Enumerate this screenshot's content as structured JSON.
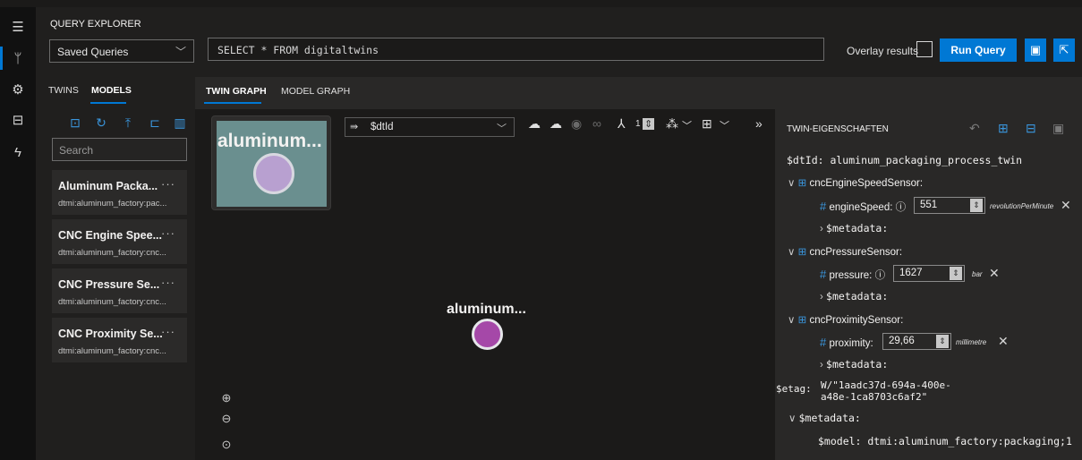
{
  "rail": {
    "icons": [
      "hamburger-icon",
      "graph-icon",
      "models-icon",
      "briefcase-icon",
      "lightning-icon"
    ]
  },
  "topbar": {
    "title": "QUERY EXPLORER",
    "saved_queries": "Saved Queries",
    "query": "SELECT * FROM digitaltwins",
    "overlay_label": "Overlay results",
    "run_query": "Run Query"
  },
  "left_panel": {
    "tabs": [
      "TWINS",
      "MODELS"
    ],
    "active_tab": "MODELS",
    "search_placeholder": "Search",
    "models": [
      {
        "name": "Aluminum Packa...",
        "id": "dtmi:aluminum_factory:pac..."
      },
      {
        "name": "CNC Engine Spee...",
        "id": "dtmi:aluminum_factory:cnc..."
      },
      {
        "name": "CNC Pressure Se...",
        "id": "dtmi:aluminum_factory:cnc..."
      },
      {
        "name": "CNC Proximity Se...",
        "id": "dtmi:aluminum_factory:cnc..."
      }
    ],
    "more": "···"
  },
  "center": {
    "tabs": [
      "TWIN GRAPH",
      "MODEL GRAPH"
    ],
    "active_tab": "TWIN GRAPH",
    "minimap_label": "aluminum...",
    "dtid_select": "$dtId",
    "node_label": "aluminum...",
    "layer_count": "1"
  },
  "properties": {
    "title": "TWIN-EIGENSCHAFTEN",
    "dtid_line": "$dtId: aluminum_packaging_process_twin",
    "components": [
      {
        "name": "cncEngineSpeedSensor:",
        "prop": "engineSpeed:",
        "value": "551",
        "unit": "revolutionPerMinute"
      },
      {
        "name": "cncPressureSensor:",
        "prop": "pressure:",
        "value": "1627",
        "unit": "bar"
      },
      {
        "name": "cncProximitySensor:",
        "prop": "proximity:",
        "value": "29,66",
        "unit": "millimetre"
      }
    ],
    "metadata_label": "$metadata:",
    "etag_key": "$etag:",
    "etag_line1": "W/\"1aadc37d-694a-400e-",
    "etag_line2": "a48e-1ca8703c6af2\"",
    "metadata_root": "$metadata:",
    "model_line": "$model: dtmi:aluminum_factory:packaging;1"
  },
  "colors": {
    "accent": "#0078d4",
    "node": "#a548a8"
  }
}
